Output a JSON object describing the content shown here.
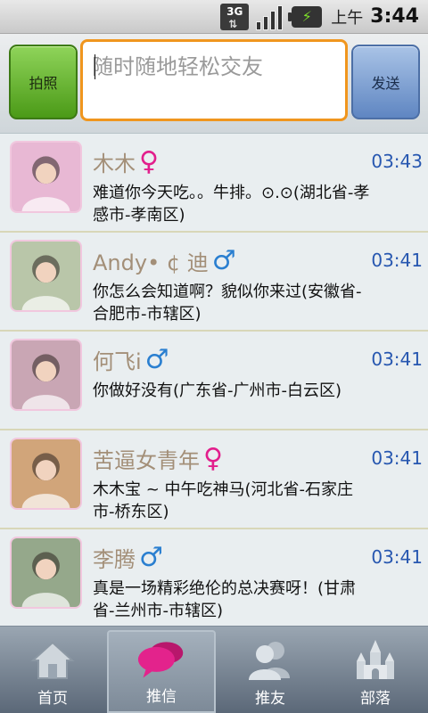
{
  "status_bar": {
    "network": "3G",
    "ampm": "上午",
    "time": "3:44"
  },
  "compose": {
    "photo_button": "拍照",
    "placeholder": "随时随地轻松交友",
    "send_button": "发送"
  },
  "feed": {
    "posts": [
      {
        "name": "木木",
        "gender": "female",
        "time": "03:43",
        "message": "难道你今天吃。。牛排。⊙.⊙(湖北省-孝感市-孝南区)",
        "avatar_color": "#e8b8d4"
      },
      {
        "name": "Andy• ¢ 迪",
        "gender": "male",
        "time": "03:41",
        "message": "你怎么会知道啊？貌似你来过(安徽省-合肥市-市辖区)",
        "avatar_color": "#b9c6a9"
      },
      {
        "name": "何飞i",
        "gender": "male",
        "time": "03:41",
        "message": "你做好没有(广东省-广州市-白云区)",
        "avatar_color": "#c9a6b4"
      },
      {
        "name": "苦逼女青年",
        "gender": "female",
        "time": "03:41",
        "message": "木木宝 ~ 中午吃神马(河北省-石家庄市-桥东区)",
        "avatar_color": "#d1a57a"
      },
      {
        "name": "李腾",
        "gender": "male",
        "time": "03:41",
        "message": "真是一场精彩绝伦的总决赛呀！(甘肃省-兰州市-市辖区)",
        "avatar_color": "#95a88b"
      }
    ]
  },
  "tabs": [
    {
      "label": "首页",
      "icon": "home-icon"
    },
    {
      "label": "推信",
      "icon": "chat-bubbles-icon",
      "active": true
    },
    {
      "label": "推友",
      "icon": "friends-icon"
    },
    {
      "label": "部落",
      "icon": "castle-icon"
    }
  ],
  "colors": {
    "female_symbol": "#e21e8c",
    "male_symbol": "#2a7fd0",
    "name_text": "#a38f78",
    "time_text": "#2757b0",
    "input_border": "#f0961e"
  }
}
